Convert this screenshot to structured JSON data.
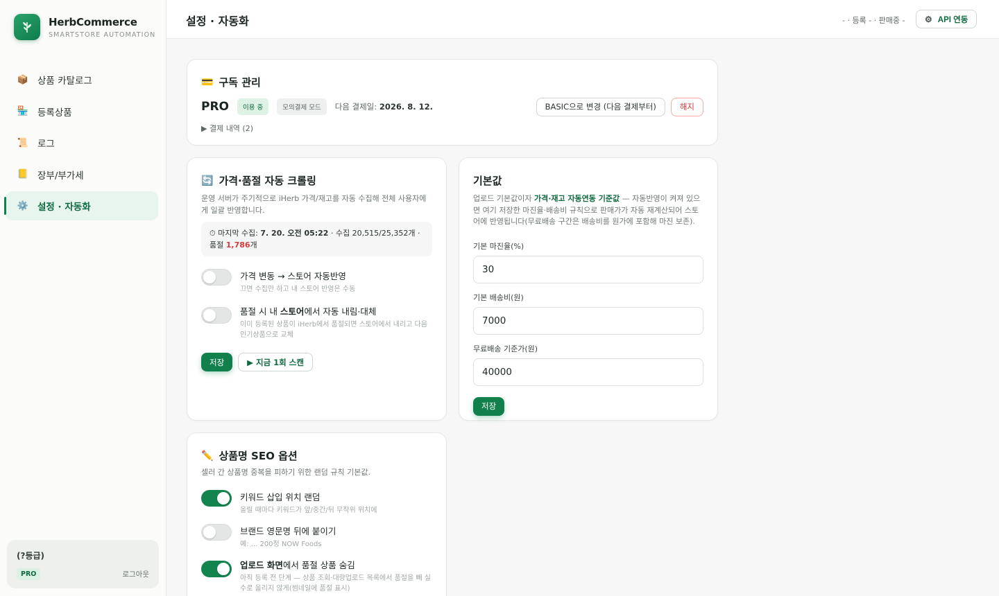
{
  "brand": {
    "name": "HerbCommerce",
    "subtitle": "SMARTSTORE AUTOMATION",
    "logo_icon": "leaf-icon"
  },
  "nav": [
    {
      "icon": "📦",
      "label": "상품 카탈로그",
      "active": false
    },
    {
      "icon": "🏪",
      "label": "등록상품",
      "active": false
    },
    {
      "icon": "📜",
      "label": "로그",
      "active": false
    },
    {
      "icon": "📒",
      "label": "장부/부가세",
      "active": false
    },
    {
      "icon": "⚙️",
      "label": "설정 · 자동화",
      "active": true
    }
  ],
  "user": {
    "grade": "(?등급)",
    "plan": "PRO",
    "logout": "로그아웃"
  },
  "header": {
    "title": "설정 · 자동화",
    "status": "- · 등록 - · 판매중 -",
    "api_button": "API 연동"
  },
  "subscription": {
    "title": "구독 관리",
    "plan": "PRO",
    "status_chip": "이용 중",
    "mode_chip": "모의결제 모드",
    "next_payment_label": "다음 결제일:",
    "next_payment_date": "2026. 8. 12.",
    "change_button": "BASIC으로 변경 (다음 결제부터)",
    "cancel_button": "해지",
    "history_toggle": "▶ 결제 내역 (2)"
  },
  "crawl": {
    "title": "가격·품절 자동 크롤링",
    "description": "운영 서버가 주기적으로 iHerb 가격/재고를 자동 수집해 전체 사용자에게 일괄 반영합니다.",
    "info": {
      "prefix": "⏱ 마지막 수집: ",
      "time": "7. 20. 오전 05:22",
      "middle": " · 수집 20,515/25,352개 · 품절 ",
      "soldout": "1,786",
      "suffix": "개"
    },
    "toggles": [
      {
        "label": "가격 변동 → 스토어 자동반영",
        "sub": "끄면 수집만 하고 내 스토어 반영은 수동",
        "on": false
      },
      {
        "label_pre": "품절 시 내 ",
        "label_bold": "스토어",
        "label_post": "에서 자동 내림·대체",
        "sub": "이미 등록된 상품이 iHerb에서 품절되면 스토어에서 내리고 다음 인기상품으로 교체",
        "on": false
      }
    ],
    "save_button": "저장",
    "scan_button": "▶ 지금 1회 스캔"
  },
  "defaults": {
    "title": "기본값",
    "desc_pre": "업로드 기본값이자 ",
    "desc_bold": "가격·재고 자동연동 기준값",
    "desc_post": " — 자동반영이 켜져 있으면 여기 저장한 마진율·배송비 규칙으로 판매가가 자동 재계산되어 스토어에 반영됩니다(무료배송 구간은 배송비를 원가에 포함해 마진 보존).",
    "fields": [
      {
        "label": "기본 마진율(%)",
        "value": "30"
      },
      {
        "label": "기본 배송비(원)",
        "value": "7000"
      },
      {
        "label": "무료배송 기준가(원)",
        "value": "40000"
      }
    ],
    "save_button": "저장"
  },
  "seo": {
    "title": "상품명 SEO 옵션",
    "description": "셀러 간 상품명 중복을 피하기 위한 랜덤 규칙 기본값.",
    "toggles": [
      {
        "label": "키워드 삽입 위치 랜덤",
        "sub": "올릴 때마다 키워드가 앞/중간/뒤 무작위 위치에",
        "on": true
      },
      {
        "label": "브랜드 영문명 뒤에 붙이기",
        "sub": "예: ... 200정 NOW Foods",
        "on": false
      },
      {
        "label_bold": "업로드 화면",
        "label_post": "에서 품절 상품 숨김",
        "sub": "아직 등록 전 단계 — 상품 조회·대량업로드 목록에서 품절을 빼 실수로 올리지 않게(썸네일에 품절 표시)",
        "on": true
      }
    ]
  },
  "colors": {
    "accent": "#12804c",
    "danger": "#d13b3b",
    "sidebar_active_bg": "#e8f5ee"
  }
}
